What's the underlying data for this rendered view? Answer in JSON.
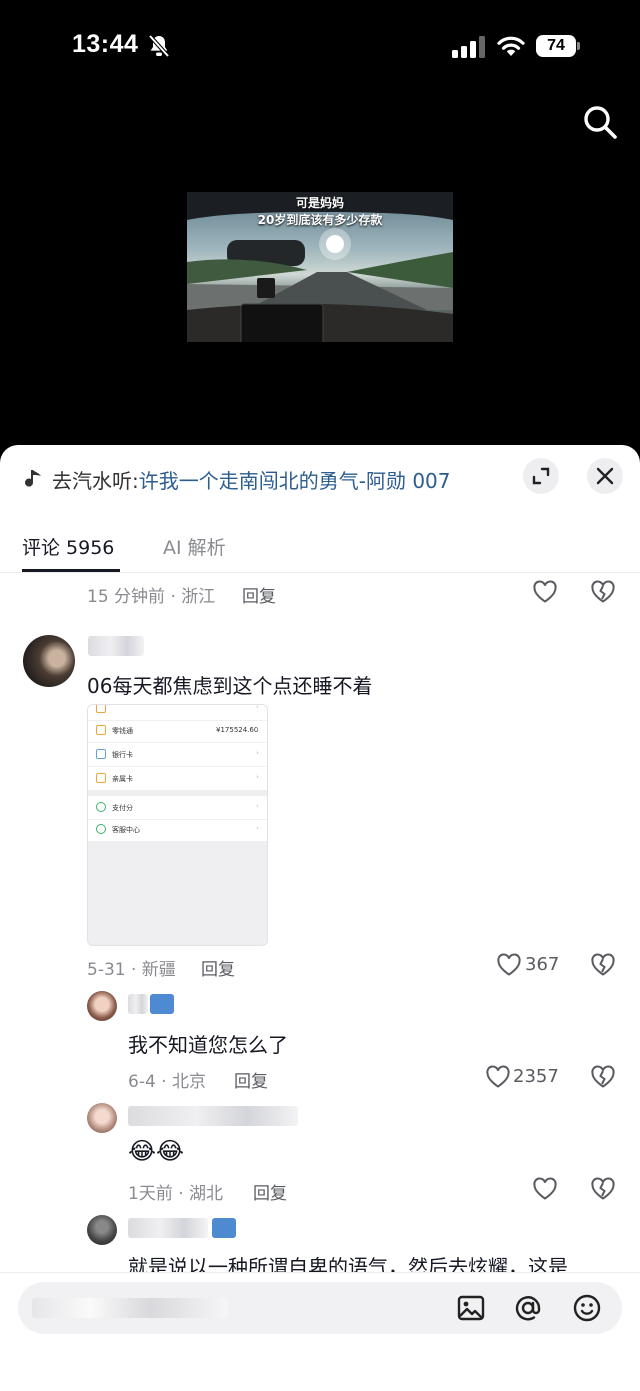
{
  "status_bar": {
    "time": "13:44",
    "battery": "74",
    "icons": [
      "bell-slash-icon",
      "cellular-signal-icon",
      "wifi-icon",
      "battery-icon"
    ]
  },
  "video": {
    "caption_line1": "可是妈妈",
    "caption_line2": "20岁到底该有多少存款"
  },
  "sheet": {
    "music_prefix": "去汽水听:",
    "music_title": "许我一个走南闯北的勇气-阿勋 007",
    "tabs": [
      {
        "label": "评论 5956",
        "active": true
      },
      {
        "label": "AI 解析",
        "active": false
      }
    ]
  },
  "comments": {
    "prev_meta": "15 分钟前 · 浙江",
    "reply_label": "回复",
    "main": {
      "text": "06每天都焦虑到这个点还睡不着",
      "meta": "5-31 · 新疆",
      "likes": "367",
      "attachment": {
        "rows": [
          {
            "label": "零钱通",
            "value": "¥175524.60"
          },
          {
            "label": "银行卡",
            "value": ""
          },
          {
            "label": "亲属卡",
            "value": ""
          },
          {
            "label": "支付分",
            "value": ""
          },
          {
            "label": "客服中心",
            "value": ""
          }
        ]
      }
    },
    "replies": [
      {
        "text": "我不知道您怎么了",
        "meta": "6-4 · 北京",
        "likes": "2357"
      },
      {
        "text": "😂😂",
        "meta": "1天前 · 湖北",
        "likes": ""
      },
      {
        "text": "就是说以一种所谓自卑的语气，然后去炫耀，这是",
        "meta": "",
        "likes": ""
      }
    ]
  },
  "input_bar": {
    "icons": [
      "image-icon",
      "at-icon",
      "emoji-icon"
    ]
  },
  "colors": {
    "accent_link": "#2c5d8f",
    "muted_text": "#8a8b91"
  }
}
